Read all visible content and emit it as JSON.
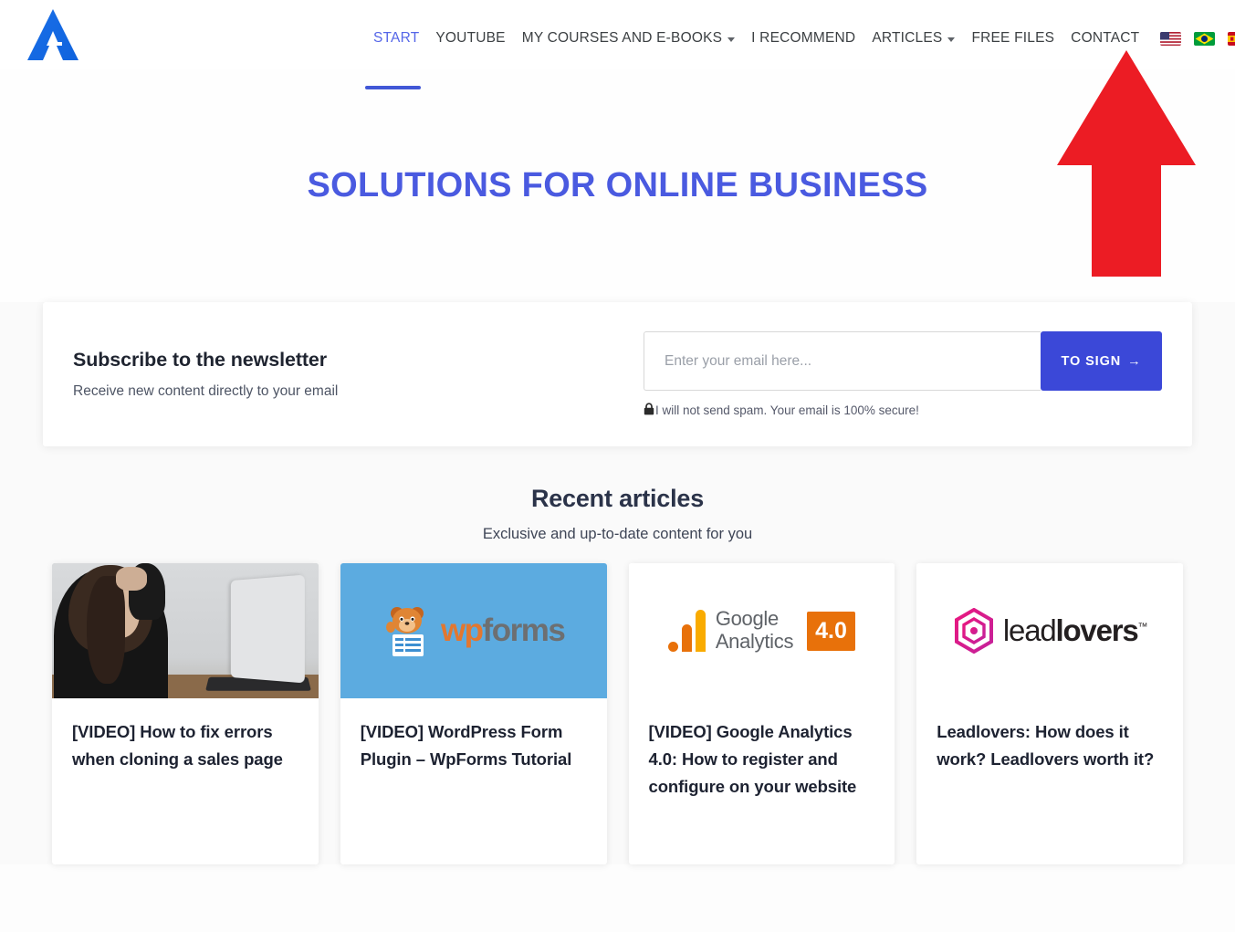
{
  "brand": {
    "logo_name": "site-logo-a",
    "accent": "#4a5ae0"
  },
  "header": {
    "nav": [
      {
        "label": "START",
        "active": true,
        "has_dropdown": false
      },
      {
        "label": "YOUTUBE",
        "active": false,
        "has_dropdown": false
      },
      {
        "label": "MY COURSES AND E-BOOKS",
        "active": false,
        "has_dropdown": true
      },
      {
        "label": "I RECOMMEND",
        "active": false,
        "has_dropdown": false
      },
      {
        "label": "ARTICLES",
        "active": false,
        "has_dropdown": true
      },
      {
        "label": "FREE FILES",
        "active": false,
        "has_dropdown": false
      },
      {
        "label": "CONTACT",
        "active": false,
        "has_dropdown": false
      }
    ],
    "flags": [
      {
        "name": "flag-united-states",
        "title": "English"
      },
      {
        "name": "flag-brazil",
        "title": "Portugues"
      },
      {
        "name": "flag-spain",
        "title": "Espanol"
      }
    ],
    "search_icon": "search-icon"
  },
  "annotation": {
    "arrow": "red-up-arrow",
    "color": "#ec1c24"
  },
  "hero": {
    "title": "SOLUTIONS FOR ONLINE BUSINESS"
  },
  "newsletter": {
    "title": "Subscribe to the newsletter",
    "subtitle": "Receive new content directly to your email",
    "email_placeholder": "Enter your email here...",
    "email_value": "",
    "submit_label": "TO SIGN",
    "submit_arrow": "→",
    "lock_icon": "🔒",
    "privacy_note": "I will not send spam. Your email is 100% secure!",
    "button_color": "#3b48d8"
  },
  "articles": {
    "heading": "Recent articles",
    "subheading": "Exclusive and up-to-date content for you",
    "cards": [
      {
        "title": "[VIDEO] How to fix errors when cloning a sales page",
        "thumb_kind": "photo",
        "thumb_name": "frustrated-person-at-laptop-photo"
      },
      {
        "title": "[VIDEO] WordPress Form Plugin – WpForms Tutorial",
        "thumb_kind": "wpforms",
        "thumb_name": "wpforms-logo",
        "logo_part1": "wp",
        "logo_part2": "forms",
        "bg": "#5cabe0"
      },
      {
        "title": "[VIDEO] Google Analytics 4.0: How to register and configure on your website",
        "thumb_kind": "analytics",
        "thumb_name": "google-analytics-logo",
        "logo_line1": "Google",
        "logo_line2": "Analytics",
        "badge": "4.0",
        "badge_color": "#e8710a"
      },
      {
        "title": "Leadlovers: How does it work? Leadlovers worth it?",
        "thumb_kind": "leadlovers",
        "thumb_name": "leadlovers-logo",
        "logo_part1": "lead",
        "logo_part2": "lovers",
        "trademark": "™"
      }
    ]
  }
}
